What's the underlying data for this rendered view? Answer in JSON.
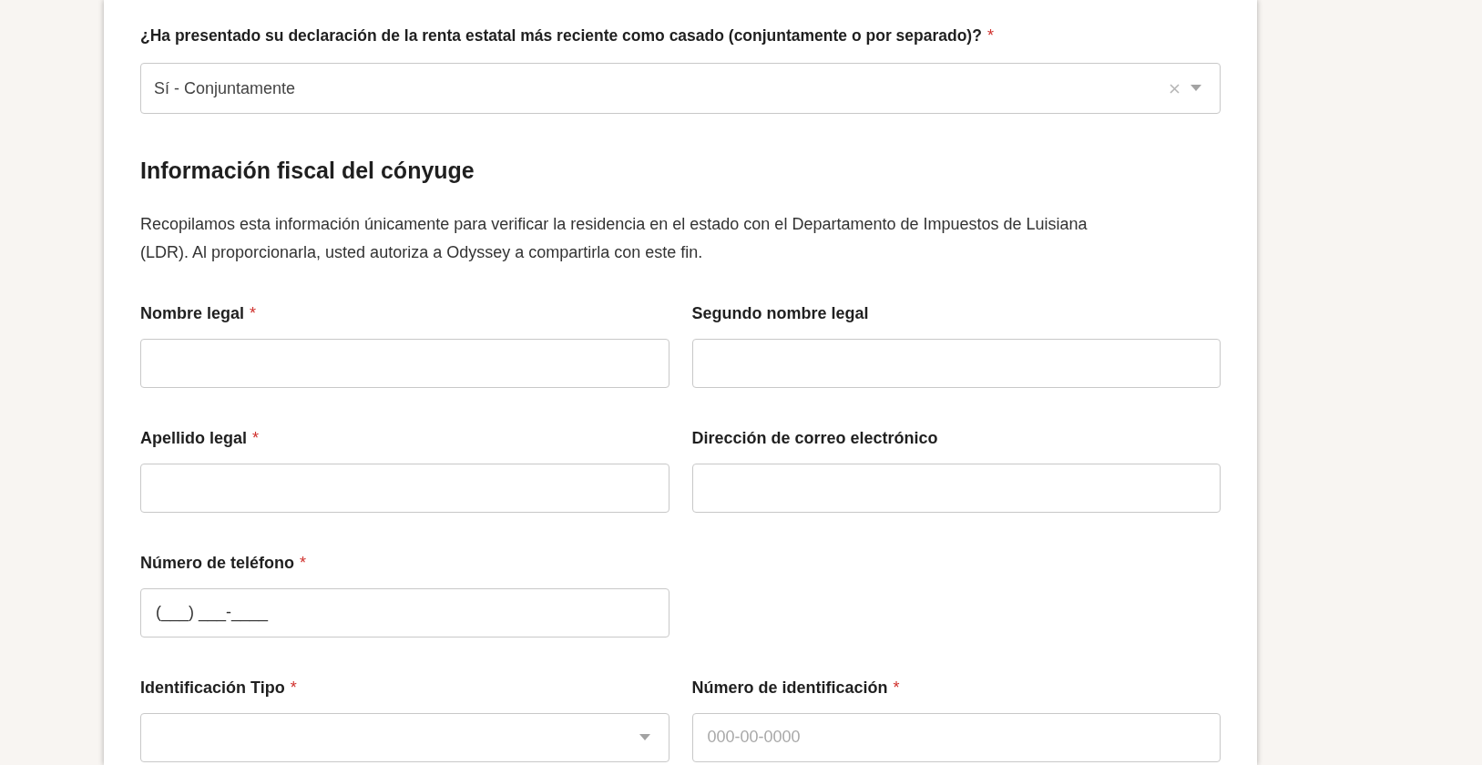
{
  "question": {
    "label": "¿Ha presentado su declaración de la renta estatal más reciente como casado (conjuntamente o por separado)?",
    "required_mark": "*",
    "value": "Sí - Conjuntamente",
    "clearable": true
  },
  "section": {
    "title": "Información fiscal del cónyuge",
    "description": "Recopilamos esta información únicamente para verificar la residencia en el estado con el Departamento de Impuestos de Luisiana (LDR). Al proporcionarla, usted autoriza a Odyssey a compartirla con este fin."
  },
  "fields": [
    {
      "kind": "text",
      "label": "Nombre legal",
      "required_mark": "*"
    },
    {
      "kind": "text",
      "label": "Segundo nombre legal"
    },
    {
      "kind": "text",
      "label": "Apellido legal",
      "required_mark": "*"
    },
    {
      "kind": "text",
      "label": "Dirección de correo electrónico"
    },
    {
      "kind": "text",
      "label": "Número de teléfono",
      "required_mark": "*",
      "value": "(___) ___-____"
    },
    {
      "kind": "spacer"
    },
    {
      "kind": "select",
      "label": "Identificación Tipo",
      "required_mark": "*"
    },
    {
      "kind": "text",
      "label": "Número de identificación",
      "required_mark": "*",
      "placeholder": "000-00-0000"
    }
  ]
}
